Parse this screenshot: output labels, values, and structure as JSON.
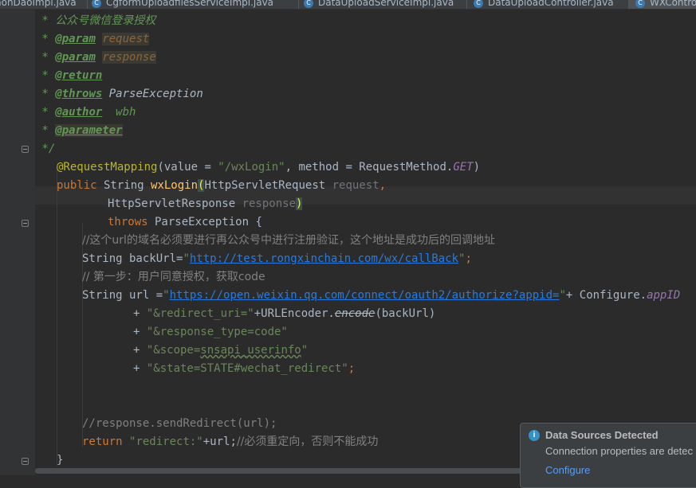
{
  "tabs": [
    {
      "label": "nonDaoImpl.java"
    },
    {
      "label": "CgformUploadfilesServiceImpl.java"
    },
    {
      "label": "DataUploadServiceImpl.java"
    },
    {
      "label": "DataUploadController.java"
    },
    {
      "label": "WXContro"
    }
  ],
  "code": {
    "l1_star": " * ",
    "l1_text": "公众号微信登录授权",
    "l2_tag": "@param",
    "l2_val": "request",
    "l3_tag": "@param",
    "l3_val": "response",
    "l4_tag": "@return",
    "l5_tag": "@throws",
    "l5_val": "ParseException",
    "l6_tag": "@author",
    "l6_val": "wbh",
    "l7_tag": "@parameter",
    "l8": " */",
    "l9_ann": "@RequestMapping",
    "l9_a": "(value = ",
    "l9_str": "\"/wxLogin\"",
    "l9_b": ", method = RequestMethod.",
    "l9_get": "GET",
    "l9_c": ")",
    "l10_kw": "public",
    "l10_a": " String ",
    "l10_name": "wxLogin",
    "l10_paren": "(",
    "l10_b": "HttpServletRequest ",
    "l10_p": "request",
    "l10_c": ",",
    "l11_a": "HttpServletResponse ",
    "l11_p": "response",
    "l11_paren": ")",
    "l12_kw": "throws",
    "l12_a": " ParseException {",
    "l13": "//这个url的域名必须要进行再公众号中进行注册验证，这个地址是成功后的回调地址",
    "l14_a": "String backUrl=",
    "l14_q1": "\"",
    "l14_link": "http://test.rongxinchain.com/wx/callBack",
    "l14_q2": "\"",
    "l14_b": ";",
    "l15": "// 第一步：用户同意授权，获取code",
    "l16_a": "String url =",
    "l16_q1": "\"",
    "l16_link": "https://open.weixin.qq.com/connect/oauth2/authorize?appid=",
    "l16_q2": "\"",
    "l16_b": "+ Configure.",
    "l16_fld": "appID",
    "l17_a": "+ ",
    "l17_str": "\"&redirect_uri=\"",
    "l17_b": "+URLEncoder.",
    "l17_m": "encode",
    "l17_c": "(backUrl)",
    "l18_a": "+ ",
    "l18_str": "\"&response_type=code\"",
    "l19_a": "+ ",
    "l19_s1": "\"&scope=",
    "l19_s2": "snsapi_userinfo",
    "l19_s3": "\"",
    "l20_a": "+ ",
    "l20_str": "\"&state=STATE#wechat_redirect\"",
    "l20_b": ";",
    "l23": "//response.sendRedirect(url);",
    "l24_kw": "return ",
    "l24_str": "\"redirect:\"",
    "l24_a": "+url;",
    "l24_cmt": "//必须重定向，否则不能成功",
    "l25": "}"
  },
  "notification": {
    "icon": "info-icon",
    "title": "Data Sources Detected",
    "message": "Connection properties are detec",
    "action": "Configure"
  }
}
